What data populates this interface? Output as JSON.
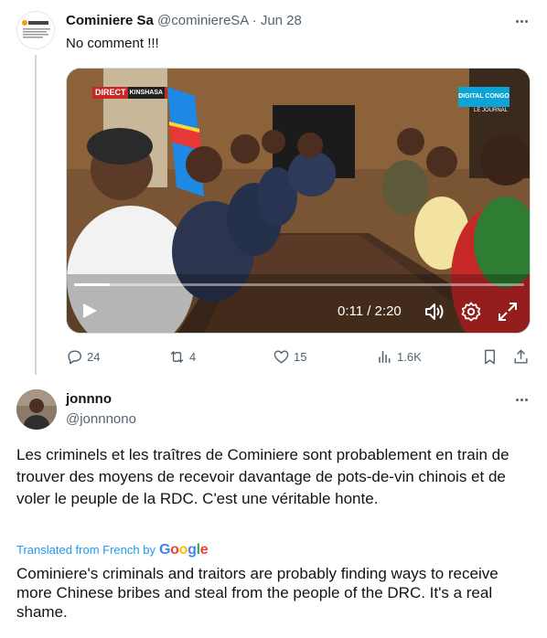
{
  "tweet": {
    "author": {
      "name": "Cominiere Sa",
      "handle": "@cominiereSA",
      "separator": "·",
      "date": "Jun 28",
      "avatar_icon": "cominiere-logo"
    },
    "text": "No comment !!!",
    "video": {
      "overlay_badge": "DIRECT",
      "overlay_badge_city": "KINSHASA",
      "channel_logo": "DIGITAL CONGO",
      "channel_sub": "LE JOURNAL",
      "time": "0:11 / 2:20",
      "progress_fraction": 0.079,
      "controls": [
        "play-icon",
        "volume-icon",
        "settings-icon",
        "fullscreen-icon"
      ]
    },
    "stats": {
      "replies": "24",
      "retweets": "4",
      "likes": "15",
      "views": "1.6K"
    }
  },
  "reply": {
    "author": {
      "name": "jonnno",
      "handle": "@jonnnono"
    },
    "text": "Les criminels et les traîtres de Cominiere sont probablement en train de trouver des moyens de recevoir davantage de pots-de-vin chinois et de voler le peuple de la RDC. C'est une véritable honte.",
    "translation_label": "Translated from French by",
    "translation_provider": "Google",
    "translation": "Cominiere's criminals and traitors are probably finding ways to receive more Chinese bribes and steal from the people of the DRC. It's a real shame."
  },
  "colors": {
    "text": "#0f1419",
    "muted": "#536471",
    "link": "#1d9bf0",
    "divider": "#cfd9de"
  }
}
